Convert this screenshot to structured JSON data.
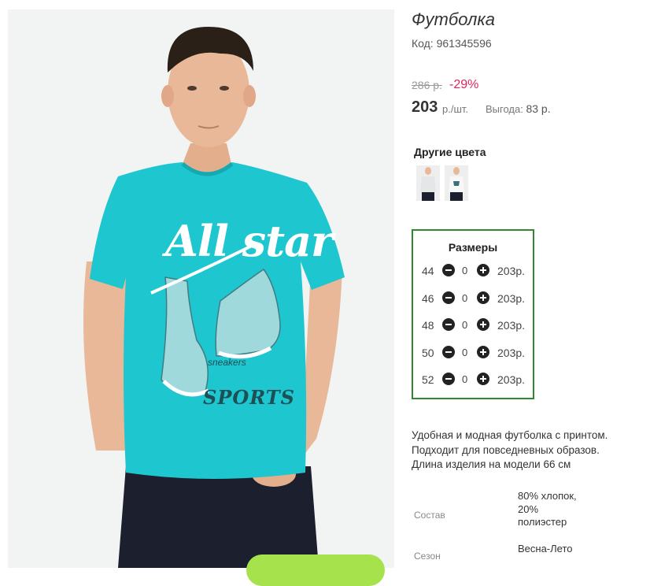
{
  "product": {
    "title": "Футболка",
    "code": "Код: 961345596",
    "old_price": "286 р.",
    "discount": "-29%",
    "price": "203",
    "price_unit": "р./шт.",
    "benefit_label": "Выгода:",
    "benefit_value": "83 р."
  },
  "colors": {
    "title": "Другие цвета",
    "swatches": [
      {
        "shirt_color": "#e4e6e8"
      },
      {
        "shirt_color": "#f2f2f2"
      }
    ]
  },
  "sizes": {
    "title": "Размеры",
    "rows": [
      {
        "size": "44",
        "qty": "0",
        "price": "203р."
      },
      {
        "size": "46",
        "qty": "0",
        "price": "203р."
      },
      {
        "size": "48",
        "qty": "0",
        "price": "203р."
      },
      {
        "size": "50",
        "qty": "0",
        "price": "203р."
      },
      {
        "size": "52",
        "qty": "0",
        "price": "203р."
      }
    ]
  },
  "description": "Удобная и модная футболка с принтом. Подходит для повседневных образов. Длина изделия на модели 66 см",
  "properties": [
    {
      "label": "Состав",
      "value": "80% хлопок, 20% полиэстер"
    },
    {
      "label": "Сезон",
      "value": "Весна-Лето"
    }
  ],
  "print": {
    "line1": "All star",
    "line2": "SPORTS",
    "small": "sneakers"
  },
  "theme": {
    "shirt": "#1ec6cf",
    "pants": "#1c1f2e",
    "skin": "#e8b898",
    "hair": "#2a2018",
    "accent_green": "#2d8a2d",
    "discount_red": "#e0245e",
    "cart_green": "#a5e24c"
  }
}
